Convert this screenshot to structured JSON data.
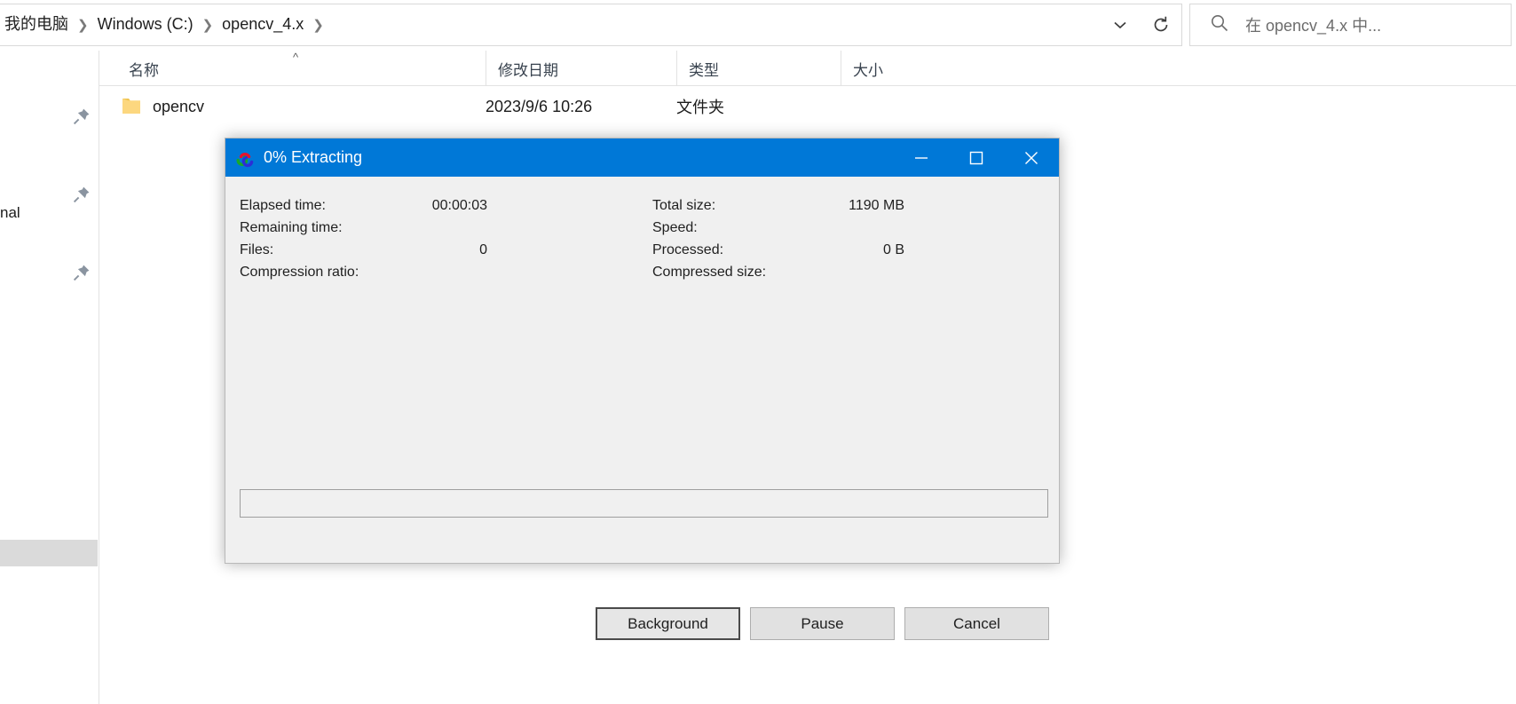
{
  "explorer": {
    "address": {
      "breadcrumbs": [
        "我的电脑",
        "Windows (C:)",
        "opencv_4.x"
      ],
      "separator": "❯",
      "dropdown_icon": "chevron-down-icon",
      "refresh_icon": "refresh-icon",
      "refresh_glyph": "↻"
    },
    "search": {
      "icon": "search-icon",
      "placeholder": "在 opencv_4.x 中...",
      "value": ""
    },
    "navpane": {
      "pins": [
        "pin-icon",
        "pin-icon",
        "pin-icon"
      ],
      "clipped_label": "nal"
    },
    "columns": [
      {
        "label": "名称",
        "sorted": "asc"
      },
      {
        "label": "修改日期",
        "sorted": ""
      },
      {
        "label": "类型",
        "sorted": ""
      },
      {
        "label": "大小",
        "sorted": ""
      }
    ],
    "rows": [
      {
        "name": "opencv",
        "modified": "2023/9/6 10:26",
        "type": "文件夹",
        "size": "",
        "icon": "folder-icon"
      }
    ]
  },
  "dialog": {
    "title": "0% Extracting",
    "icon": "sevenzip-icon",
    "window_controls": {
      "minimize": "minimize-icon",
      "maximize": "maximize-icon",
      "close": "close-icon"
    },
    "fields": {
      "left": [
        {
          "label": "Elapsed time:",
          "value": "00:00:03"
        },
        {
          "label": "Remaining time:",
          "value": ""
        },
        {
          "label": "Files:",
          "value": "0"
        },
        {
          "label": "Compression ratio:",
          "value": ""
        }
      ],
      "right": [
        {
          "label": "Total size:",
          "value": "1190 MB"
        },
        {
          "label": "Speed:",
          "value": ""
        },
        {
          "label": "Processed:",
          "value": "0 B"
        },
        {
          "label": "Compressed size:",
          "value": ""
        }
      ]
    },
    "progress": {
      "percent": 0,
      "label": "0%"
    },
    "buttons": [
      {
        "label": "Background",
        "default": true
      },
      {
        "label": "Pause",
        "default": false
      },
      {
        "label": "Cancel",
        "default": false
      }
    ]
  },
  "colors": {
    "accent": "#0078d7",
    "titlebar": "#0078d7",
    "dialog_bg": "#f0f0f0",
    "folder": "#fcd77f",
    "progress_fill": "#06b025"
  }
}
